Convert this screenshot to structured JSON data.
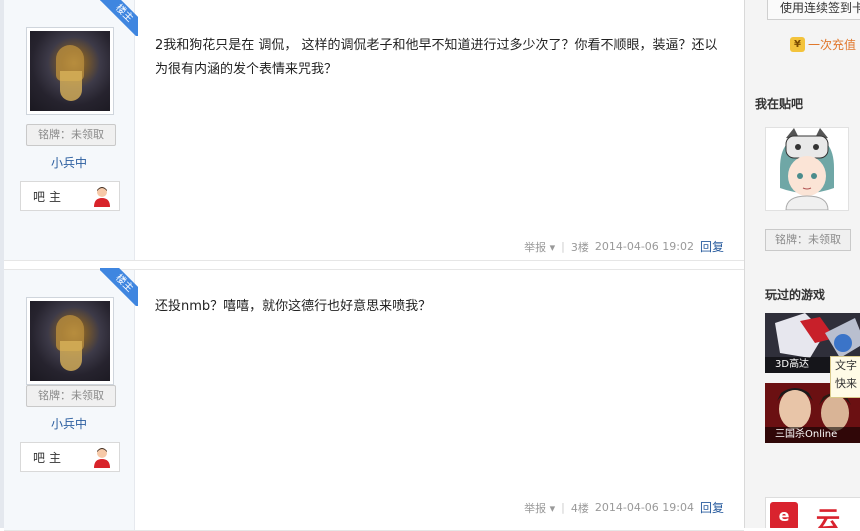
{
  "posts": [
    {
      "badge": "楼主",
      "badge_button": "铭牌：未领取",
      "username": "小兵中",
      "role": "吧主",
      "text": "2我和狗花只是在 调侃， 这样的调侃老子和他早不知道进行过多少次了？你看不顺眼，装逼？还以为很有内涵的发个表情来咒我？",
      "report": "举报",
      "floor": "3楼",
      "time": "2014-04-06 19:02",
      "reply": "回复"
    },
    {
      "badge": "楼主",
      "badge_button": "铭牌：未领取",
      "username": "小兵中",
      "role": "吧主",
      "text": "还投nmb？嘻嘻，就你这德行也好意思来喷我？",
      "report": "举报",
      "floor": "4楼",
      "time": "2014-04-06 19:04",
      "reply": "回复"
    }
  ],
  "sidebar": {
    "signin_button": "使用连续签到卡",
    "charge_link": "一次充值",
    "my_bar_title": "我在贴吧",
    "my_badge": "铭牌：未领取",
    "games_title": "玩过的游戏",
    "games": [
      {
        "caption": "3D高达"
      },
      {
        "caption": "三国杀Online"
      }
    ],
    "tooltip_lines": [
      "文字",
      "快来"
    ],
    "promo_text": "云"
  },
  "colors": {
    "accent_blue": "#3f86e0",
    "link_blue": "#2a5d9f",
    "orange": "#e0762a"
  }
}
